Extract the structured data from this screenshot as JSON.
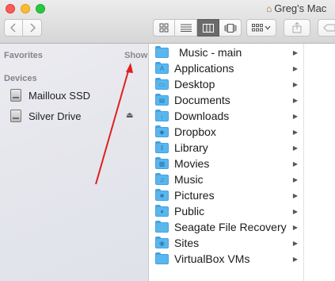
{
  "window": {
    "title": "Greg's Mac",
    "home_icon": "house-icon"
  },
  "toolbar": {
    "back_icon": "chevron-left-icon",
    "forward_icon": "chevron-right-icon",
    "views": [
      "icon-view-icon",
      "list-view-icon",
      "column-view-icon",
      "cover-flow-icon"
    ],
    "active_view": "column-view-icon",
    "arrange_icon": "arrange-grid-icon",
    "share_icon": "share-icon",
    "tags_icon": "tag-icon"
  },
  "sidebar": {
    "favorites_label": "Favorites",
    "show_label": "Show",
    "devices_label": "Devices",
    "devices": [
      {
        "label": "Mailloux SSD",
        "icon": "internal-disk-icon"
      },
      {
        "label": "Silver Drive",
        "icon": "external-disk-icon",
        "eject": "⏏"
      }
    ]
  },
  "column1": {
    "items": [
      {
        "label": "Music - main",
        "icon": "folder-icon"
      },
      {
        "label": "Applications",
        "icon": "applications-folder-icon"
      },
      {
        "label": "Desktop",
        "icon": "desktop-folder-icon"
      },
      {
        "label": "Documents",
        "icon": "documents-folder-icon"
      },
      {
        "label": "Downloads",
        "icon": "downloads-folder-icon"
      },
      {
        "label": "Dropbox",
        "icon": "dropbox-folder-icon"
      },
      {
        "label": "Library",
        "icon": "library-folder-icon"
      },
      {
        "label": "Movies",
        "icon": "movies-folder-icon"
      },
      {
        "label": "Music",
        "icon": "music-folder-icon"
      },
      {
        "label": "Pictures",
        "icon": "pictures-folder-icon"
      },
      {
        "label": "Public",
        "icon": "public-folder-icon"
      },
      {
        "label": "Seagate File Recovery",
        "icon": "folder-icon"
      },
      {
        "label": "Sites",
        "icon": "sites-folder-icon"
      },
      {
        "label": "VirtualBox VMs",
        "icon": "folder-icon"
      }
    ]
  },
  "annotation": {
    "color": "#e02020",
    "icon": "red-arrow-annotation"
  }
}
